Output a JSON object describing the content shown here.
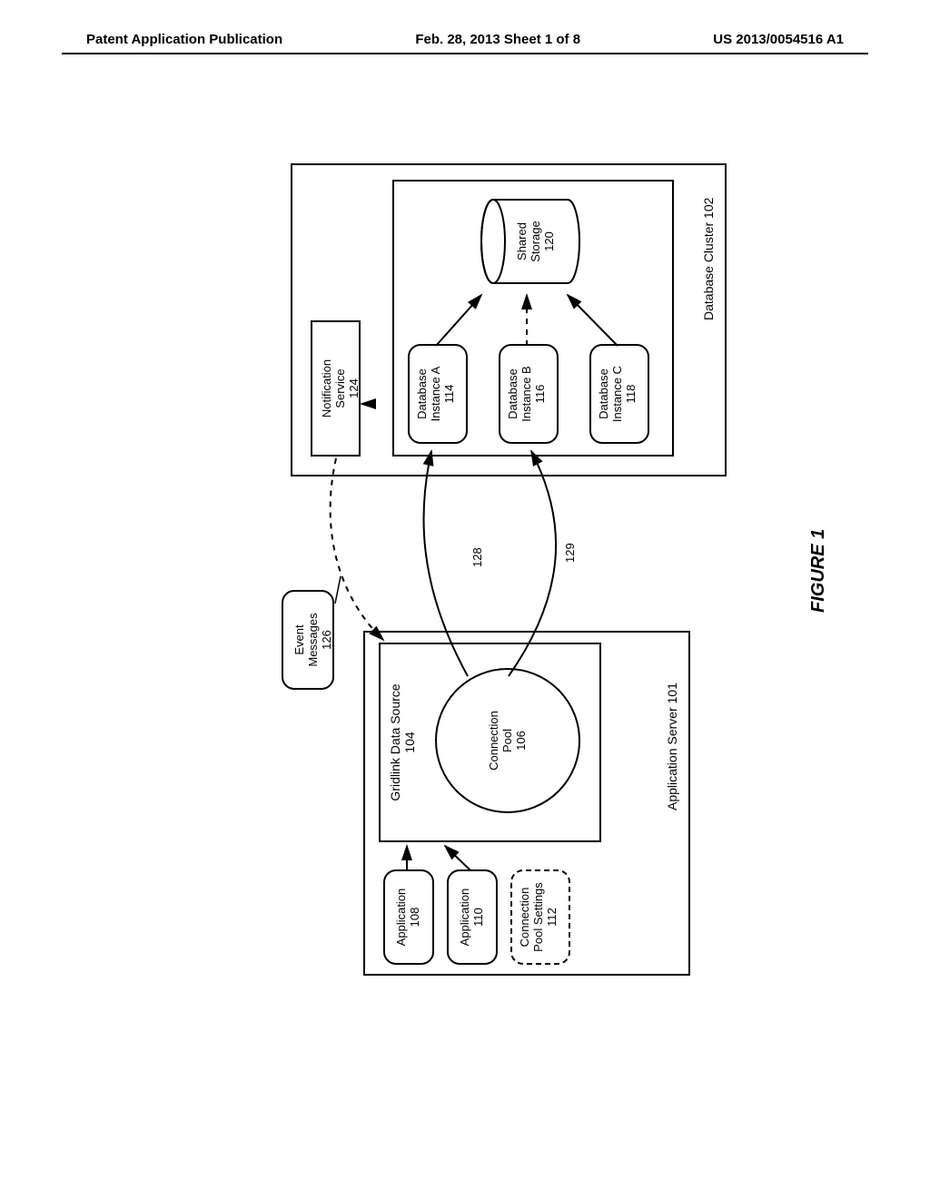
{
  "header": {
    "left": "Patent Application Publication",
    "center": "Feb. 28, 2013  Sheet 1 of 8",
    "right": "US 2013/0054516 A1"
  },
  "appServer": {
    "title": "Application Server 101",
    "gridlink": "Gridlink Data Source\n104",
    "pool": "Connection\nPool\n106",
    "app1": "Application\n108",
    "app2": "Application\n110",
    "poolSettings": "Connection\nPool Settings\n112"
  },
  "dbCluster": {
    "title": "Database Cluster 102",
    "instA": "Database\nInstance A\n114",
    "instB": "Database\nInstance B\n116",
    "instC": "Database\nInstance C\n118",
    "shared": "Shared\nStorage\n120"
  },
  "notification": "Notification\nService\n124",
  "eventMessages": "Event\nMessages\n126",
  "conn128": "128",
  "conn129": "129",
  "figure": "FIGURE 1"
}
